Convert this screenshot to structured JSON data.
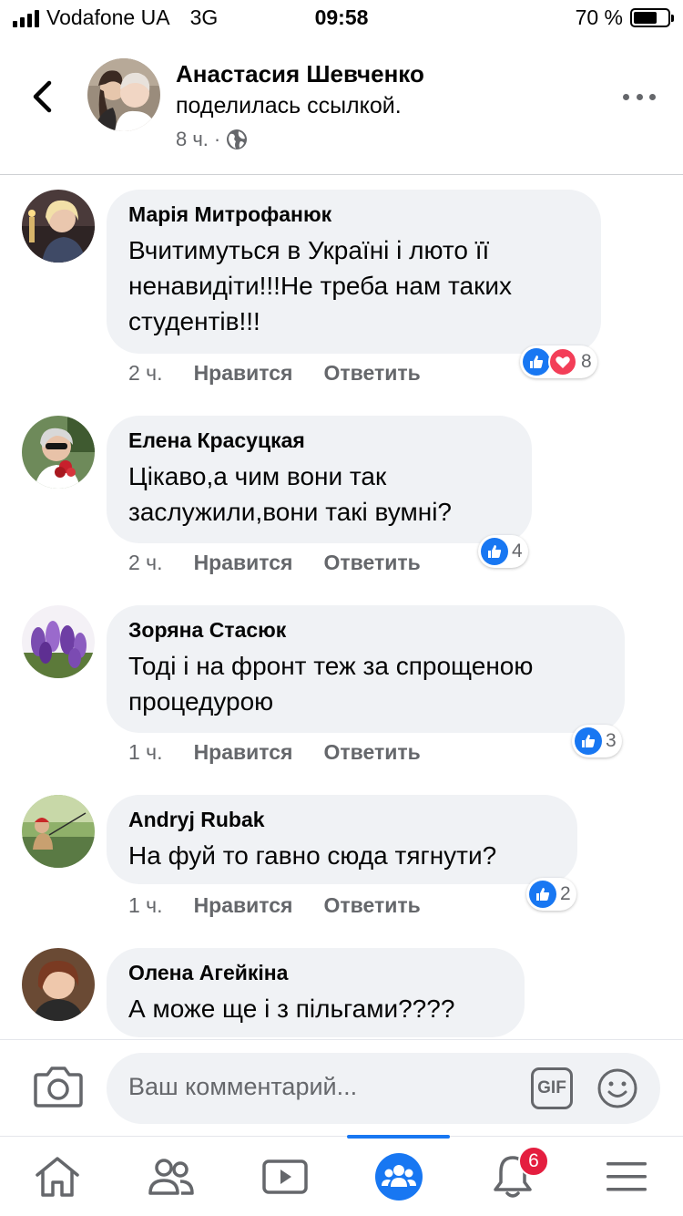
{
  "status_bar": {
    "carrier": "Vodafone UA",
    "network": "3G",
    "time": "09:58",
    "battery": "70 %",
    "battery_level": 0.7
  },
  "header": {
    "author_name": "Анастасия Шевченко",
    "action_text": "поделилась ссылкой.",
    "time": "8 ч.",
    "separator": "·",
    "privacy_icon": "globe-icon",
    "back_icon": "chevron-left-icon",
    "more_icon": "more-horizontal-icon"
  },
  "comments": [
    {
      "author": "Марія Митрофанюк",
      "text": "Вчитимуться в Україні і люто її ненавидіти!!!Не треба нам таких студентів!!!",
      "time": "2 ч.",
      "like_label": "Нравится",
      "reply_label": "Ответить",
      "reaction_count": "8",
      "reactions": [
        "like",
        "love"
      ]
    },
    {
      "author": "Елена Красуцкая",
      "text": "Цікаво,а чим вони так заслужили,вони такі вумні?",
      "time": "2 ч.",
      "like_label": "Нравится",
      "reply_label": "Ответить",
      "reaction_count": "4",
      "reactions": [
        "like"
      ]
    },
    {
      "author": "Зоряна Стасюк",
      "text": "Тоді і на фронт теж за спрощеною процедурою",
      "time": "1 ч.",
      "like_label": "Нравится",
      "reply_label": "Ответить",
      "reaction_count": "3",
      "reactions": [
        "like"
      ]
    },
    {
      "author": "Andryj Rubak",
      "text": "На фуй то гавно сюда тягнути?",
      "time": "1 ч.",
      "like_label": "Нравится",
      "reply_label": "Ответить",
      "reaction_count": "2",
      "reactions": [
        "like"
      ]
    },
    {
      "author": "Олена Агейкіна",
      "text": "А може ще і з пільгами????"
    }
  ],
  "comment_input": {
    "placeholder": "Ваш комментарий...",
    "gif_label": "GIF",
    "camera_icon": "camera-icon",
    "emoji_icon": "emoji-icon"
  },
  "tab_bar": {
    "tabs": [
      "home-icon",
      "friends-icon",
      "watch-icon",
      "groups-icon",
      "notifications-icon",
      "menu-icon"
    ],
    "active_tab": "groups-icon",
    "notifications_badge": "6"
  },
  "colors": {
    "accent": "#1877f2",
    "bubble": "#f0f2f5",
    "secondary_text": "#65676b",
    "love": "#f33e58",
    "badge": "#e41e3f"
  }
}
